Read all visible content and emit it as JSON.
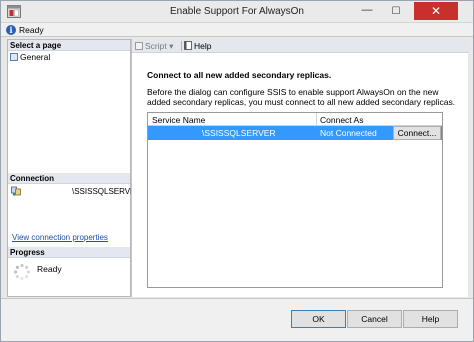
{
  "window": {
    "title": "Enable Support For AlwaysOn",
    "minimize_glyph": "—",
    "maximize_glyph": "☐",
    "close_glyph": "✕"
  },
  "status": {
    "icon": "info-icon",
    "text": "Ready"
  },
  "left_pane": {
    "select_page_header": "Select a page",
    "pages": [
      {
        "label": "General",
        "icon": "page-icon"
      }
    ],
    "connection_header": "Connection",
    "connection_server": "\\SSISSQLSERVER",
    "view_connection_link": "View connection properties",
    "progress_header": "Progress",
    "progress_status": "Ready"
  },
  "toolbar": {
    "script_label": "Script",
    "script_dropdown": "▾",
    "help_label": "Help"
  },
  "main": {
    "heading": "Connect to all new added secondary replicas.",
    "description": "Before the dialog can configure SSIS to enable support AlwaysOn on the new added secondary replicas, you must connect to all new added secondary replicas."
  },
  "grid": {
    "columns": [
      "Service Name",
      "Connect As"
    ],
    "rows": [
      {
        "service_name": "\\SSISSQLSERVER",
        "connect_as": "Not Connected",
        "button": "Connect..."
      }
    ],
    "selection_color": "#3399ff"
  },
  "buttons": {
    "ok": "OK",
    "cancel": "Cancel",
    "help": "Help"
  },
  "colors": {
    "close_button": "#c7302c",
    "link": "#1f4ea7"
  }
}
